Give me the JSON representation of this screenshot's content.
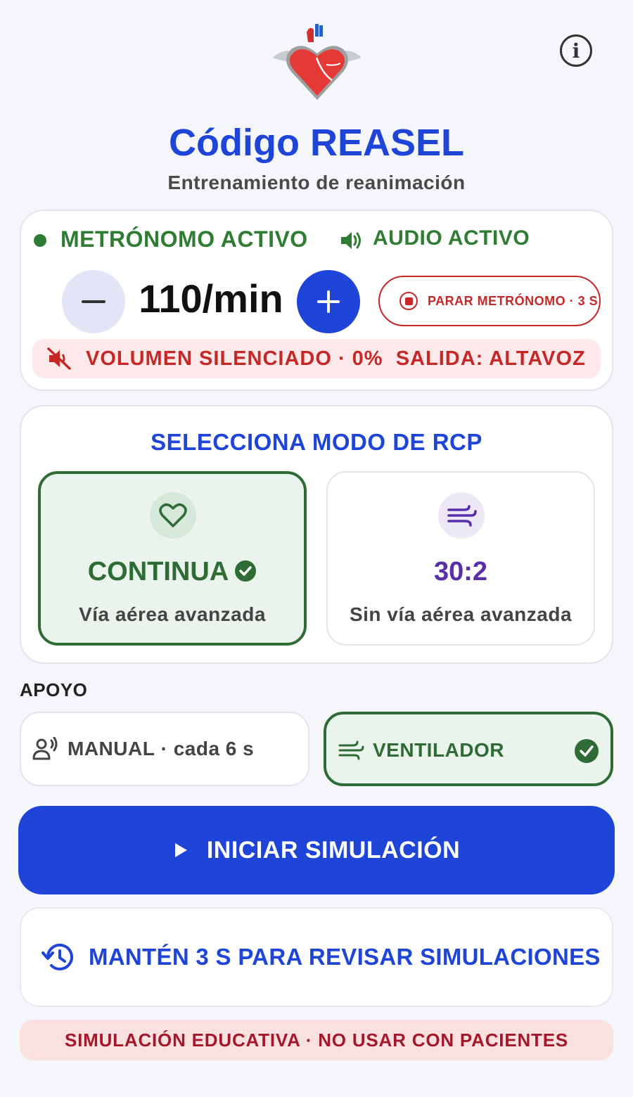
{
  "app": {
    "title": "Código REASEL",
    "subtitle": "Entrenamiento de reanimación"
  },
  "header": {
    "info_icon": "info-icon",
    "logo_icon": "heart-logo-icon"
  },
  "metronome": {
    "status_label": "METRÓNOMO ACTIVO",
    "audio_label": "AUDIO ACTIVO",
    "bpm_value": "110/min",
    "decrease_icon": "minus-icon",
    "increase_icon": "plus-icon",
    "stop_label": "PARAR METRÓNOMO · 3 S",
    "volume_status": "VOLUMEN SILENCIADO · 0%",
    "output_status": "SALIDA: ALTAVOZ",
    "colors": {
      "active": "#2e7d32",
      "warning": "#c62828",
      "primary": "#1f45d8"
    }
  },
  "mode": {
    "title": "SELECCIONA MODO DE RCP",
    "options": [
      {
        "label": "CONTINUA",
        "subtitle": "Vía aérea avanzada",
        "icon": "heart-icon",
        "selected": true
      },
      {
        "label": "30:2",
        "subtitle": "Sin vía aérea avanzada",
        "icon": "wind-icon",
        "selected": false
      }
    ]
  },
  "support": {
    "heading": "APOYO",
    "options": [
      {
        "label": "MANUAL",
        "separator": "·",
        "detail": "cada 6 s",
        "icon": "person-voice-icon",
        "selected": false
      },
      {
        "label": "VENTILADOR",
        "icon": "wind-icon",
        "selected": true
      }
    ]
  },
  "actions": {
    "start_label": "INICIAR SIMULACIÓN",
    "review_label": "MANTÉN 3 S PARA REVISAR SIMULACIONES"
  },
  "footer": {
    "disclaimer": "SIMULACIÓN EDUCATIVA · NO USAR CON PACIENTES"
  }
}
